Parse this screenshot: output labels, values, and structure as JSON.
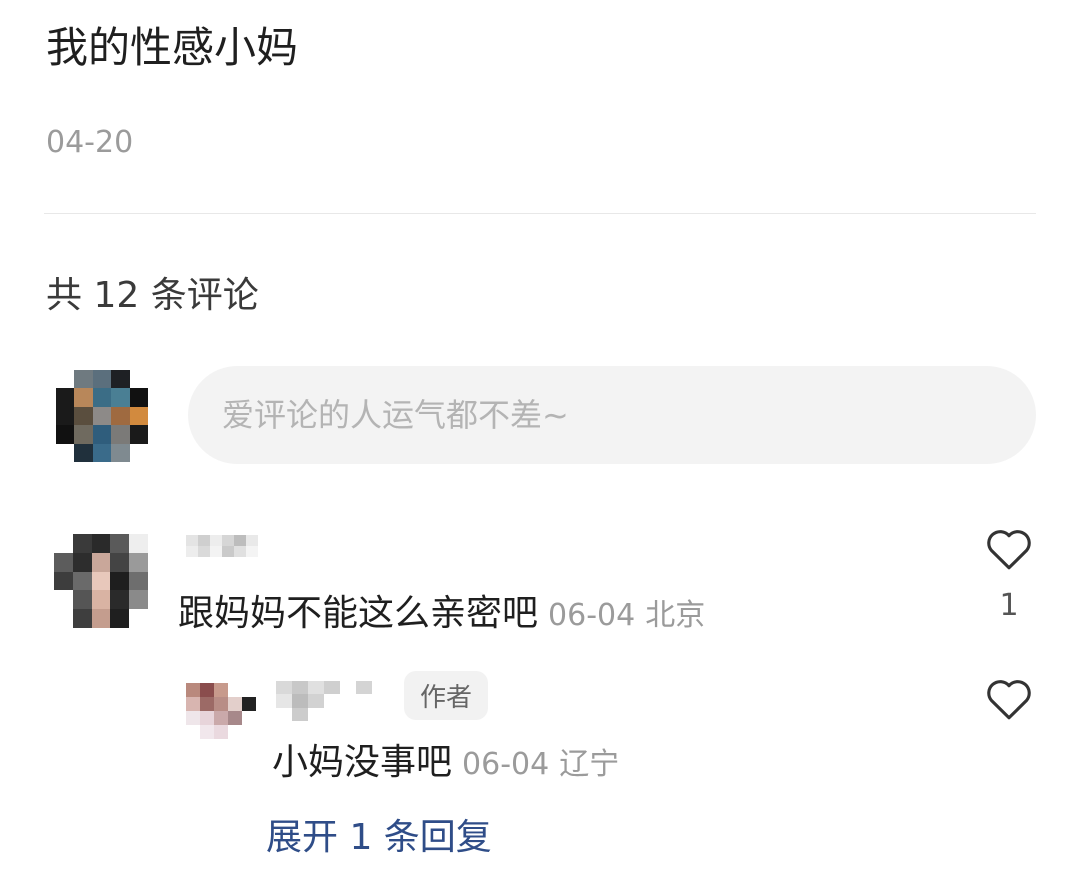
{
  "post": {
    "title": "我的性感小妈",
    "date": "04-20"
  },
  "comments_header": {
    "count_label": "共 12 条评论"
  },
  "comment_input": {
    "placeholder": "爱评论的人运气都不差~"
  },
  "comments": [
    {
      "text": "跟妈妈不能这么亲密吧",
      "date": "06-04",
      "location": "北京",
      "like_icon": "heart-outline-icon",
      "like_count": "1"
    }
  ],
  "replies": [
    {
      "badge": "作者",
      "text": "小妈没事吧",
      "date": "06-04",
      "location": "辽宁",
      "like_icon": "heart-outline-icon"
    }
  ],
  "expand_replies_label": "展开 1 条回复",
  "colors": {
    "link": "#2f4d88",
    "meta_text": "#9b9b9b",
    "input_background": "#f3f3f3"
  }
}
